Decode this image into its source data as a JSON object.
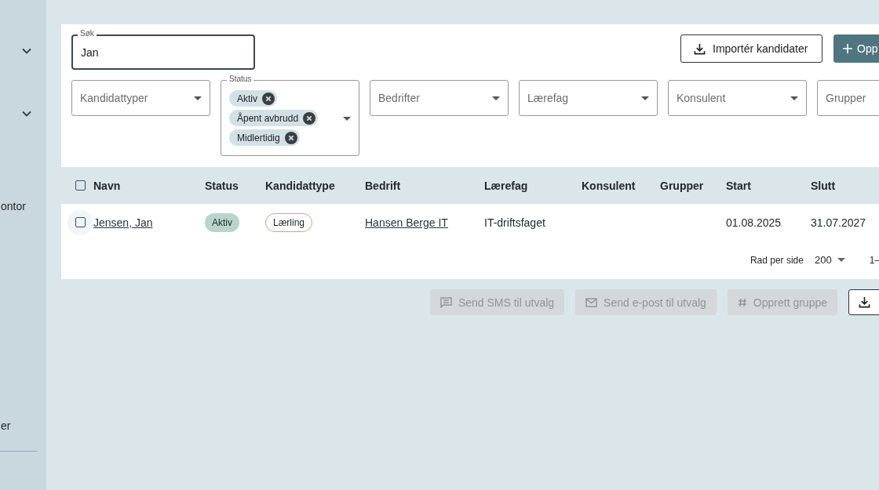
{
  "sidebar": {
    "items": [
      {
        "kind": "group"
      },
      {
        "kind": "group"
      },
      {
        "kind": "link",
        "label": "ontor"
      },
      {
        "kind": "link",
        "label": "er"
      }
    ]
  },
  "search": {
    "label": "Søk",
    "value": "Jan"
  },
  "actions": [
    {
      "kind": "outline",
      "label": "Importér kandidater"
    },
    {
      "kind": "primary",
      "label": "Opp"
    }
  ],
  "filters": [
    {
      "kind": "select",
      "placeholder": "Kandidattyper"
    },
    {
      "kind": "multiselect",
      "label": "Status",
      "chips": [
        "Aktiv",
        "Åpent avbrudd",
        "Midlertidig"
      ]
    },
    {
      "kind": "select",
      "placeholder": "Bedrifter"
    },
    {
      "kind": "select",
      "placeholder": "Lærefag"
    },
    {
      "kind": "select",
      "placeholder": "Konsulent"
    },
    {
      "kind": "select",
      "placeholder": "Grupper"
    }
  ],
  "table": {
    "all_checked": false,
    "columns": [
      "Navn",
      "Status",
      "Kandidattype",
      "Bedrift",
      "Lærefag",
      "Konsulent",
      "Grupper",
      "Start",
      "Slutt"
    ],
    "rows": [
      {
        "checked": false,
        "navn": "Jensen, Jan",
        "status": "Aktiv",
        "kandidattype": "Lærling",
        "bedrift": "Hansen Berge IT",
        "laerefag": "IT-driftsfaget",
        "start": "01.08.2025",
        "slutt": "31.07.2027"
      }
    ]
  },
  "pagination": {
    "label": "Rad per side",
    "per_page": "200",
    "range": "1–"
  },
  "bulk_actions": [
    {
      "kind": "sms",
      "label": "Send SMS til utvalg",
      "disabled": true
    },
    {
      "kind": "email",
      "label": "Send e-post til utvalg",
      "disabled": true
    },
    {
      "kind": "group",
      "label": "Opprett gruppe",
      "disabled": true
    },
    {
      "kind": "export",
      "disabled": false
    }
  ]
}
